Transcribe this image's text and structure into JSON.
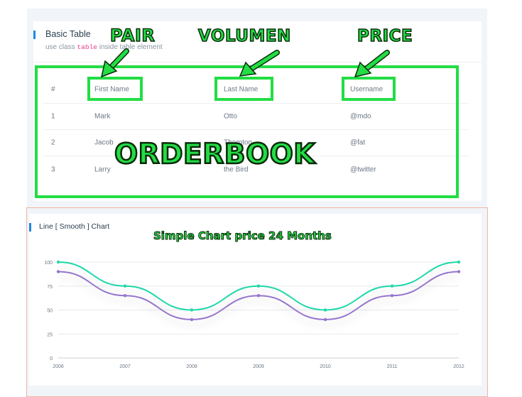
{
  "table_card": {
    "title": "Basic Table",
    "subtitle_before": "use class ",
    "subtitle_code": "table",
    "subtitle_after": " inside table element",
    "headers": [
      "#",
      "First Name",
      "Last Name",
      "Username"
    ],
    "rows": [
      [
        "1",
        "Mark",
        "Otto",
        "@mdo"
      ],
      [
        "2",
        "Jacob",
        "Thornton",
        "@fat"
      ],
      [
        "3",
        "Larry",
        "the Bird",
        "@twitter"
      ]
    ]
  },
  "annotations": {
    "pair": "PAIR",
    "volumen": "VOLUMEN",
    "price": "PRICE",
    "orderbook": "ORDERBOOK",
    "chart_caption": "Simple Chart price 24 Months",
    "color": "#22dd44"
  },
  "chart_card": {
    "title": "Line [ Smooth ] Chart"
  },
  "chart_data": {
    "type": "line",
    "x": [
      "2006",
      "2007",
      "2008",
      "2009",
      "2010",
      "2011",
      "2012"
    ],
    "series": [
      {
        "values": [
          100,
          75,
          50,
          75,
          50,
          75,
          100
        ],
        "color": "#1fd8a8"
      },
      {
        "values": [
          90,
          65,
          40,
          65,
          40,
          65,
          90
        ],
        "color": "#9575cd"
      }
    ],
    "ylim": [
      0,
      100
    ],
    "yticks": [
      "0",
      "25",
      "50",
      "75",
      "100"
    ],
    "grid": true
  }
}
